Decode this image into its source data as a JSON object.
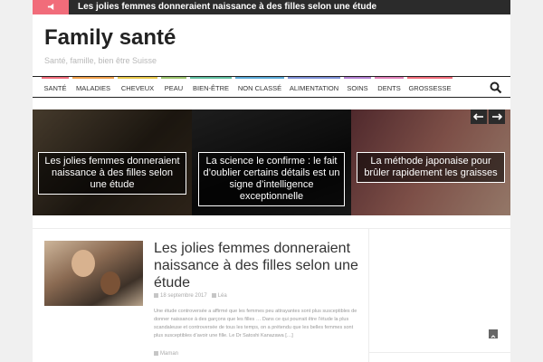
{
  "ticker": {
    "icon": "megaphone-icon",
    "badge_color": "#f16c7a",
    "headline": "Les jolies femmes donneraient naissance à des filles selon une étude"
  },
  "header": {
    "site_title": "Family santé",
    "tagline": "Santé, famille, bien être Suisse"
  },
  "nav": {
    "items": [
      {
        "label": "SANTÉ",
        "color": "#f16c7a"
      },
      {
        "label": "MALADIES",
        "color": "#f0a04b"
      },
      {
        "label": "CHEVEUX",
        "color": "#e8c84a"
      },
      {
        "label": "PEAU",
        "color": "#9bc36b"
      },
      {
        "label": "BIEN-ÊTRE",
        "color": "#5fbfa0"
      },
      {
        "label": "NON CLASSÉ",
        "color": "#5aa9d6"
      },
      {
        "label": "ALIMENTATION",
        "color": "#7d8fd6"
      },
      {
        "label": "SOINS",
        "color": "#b27fd1"
      },
      {
        "label": "DENTS",
        "color": "#e07fb8"
      },
      {
        "label": "GROSSESSE",
        "color": "#f16c7a"
      }
    ],
    "search_icon": "search-icon"
  },
  "slider": {
    "slides": [
      {
        "caption": "Les jolies femmes donneraient naissance à des filles selon une étude"
      },
      {
        "caption": "La science le confirme : le fait d’oublier certains détails est un signe d’intelligence exceptionnelle"
      },
      {
        "caption": "La méthode japonaise pour brûler rapidement les graisses"
      }
    ],
    "prev_icon": "arrow-left-icon",
    "next_icon": "arrow-right-icon"
  },
  "article": {
    "title": "Les jolies femmes donneraient naissance à des filles selon une étude",
    "date": "18 septembre 2017",
    "author": "Léa",
    "excerpt": "Une étude controversée a affirmé que les femmes peu attrayantes sont plus susceptibles de donner naissance à des garçons que les filles … Dans ce qui pourrait être l’étude la plus scandaleuse et controversée de tous les temps, on a prétendu que les belles femmes sont plus susceptibles d’avoir une fille. Le Dr Satoshi Kanazawa […]",
    "category": "Maman"
  }
}
